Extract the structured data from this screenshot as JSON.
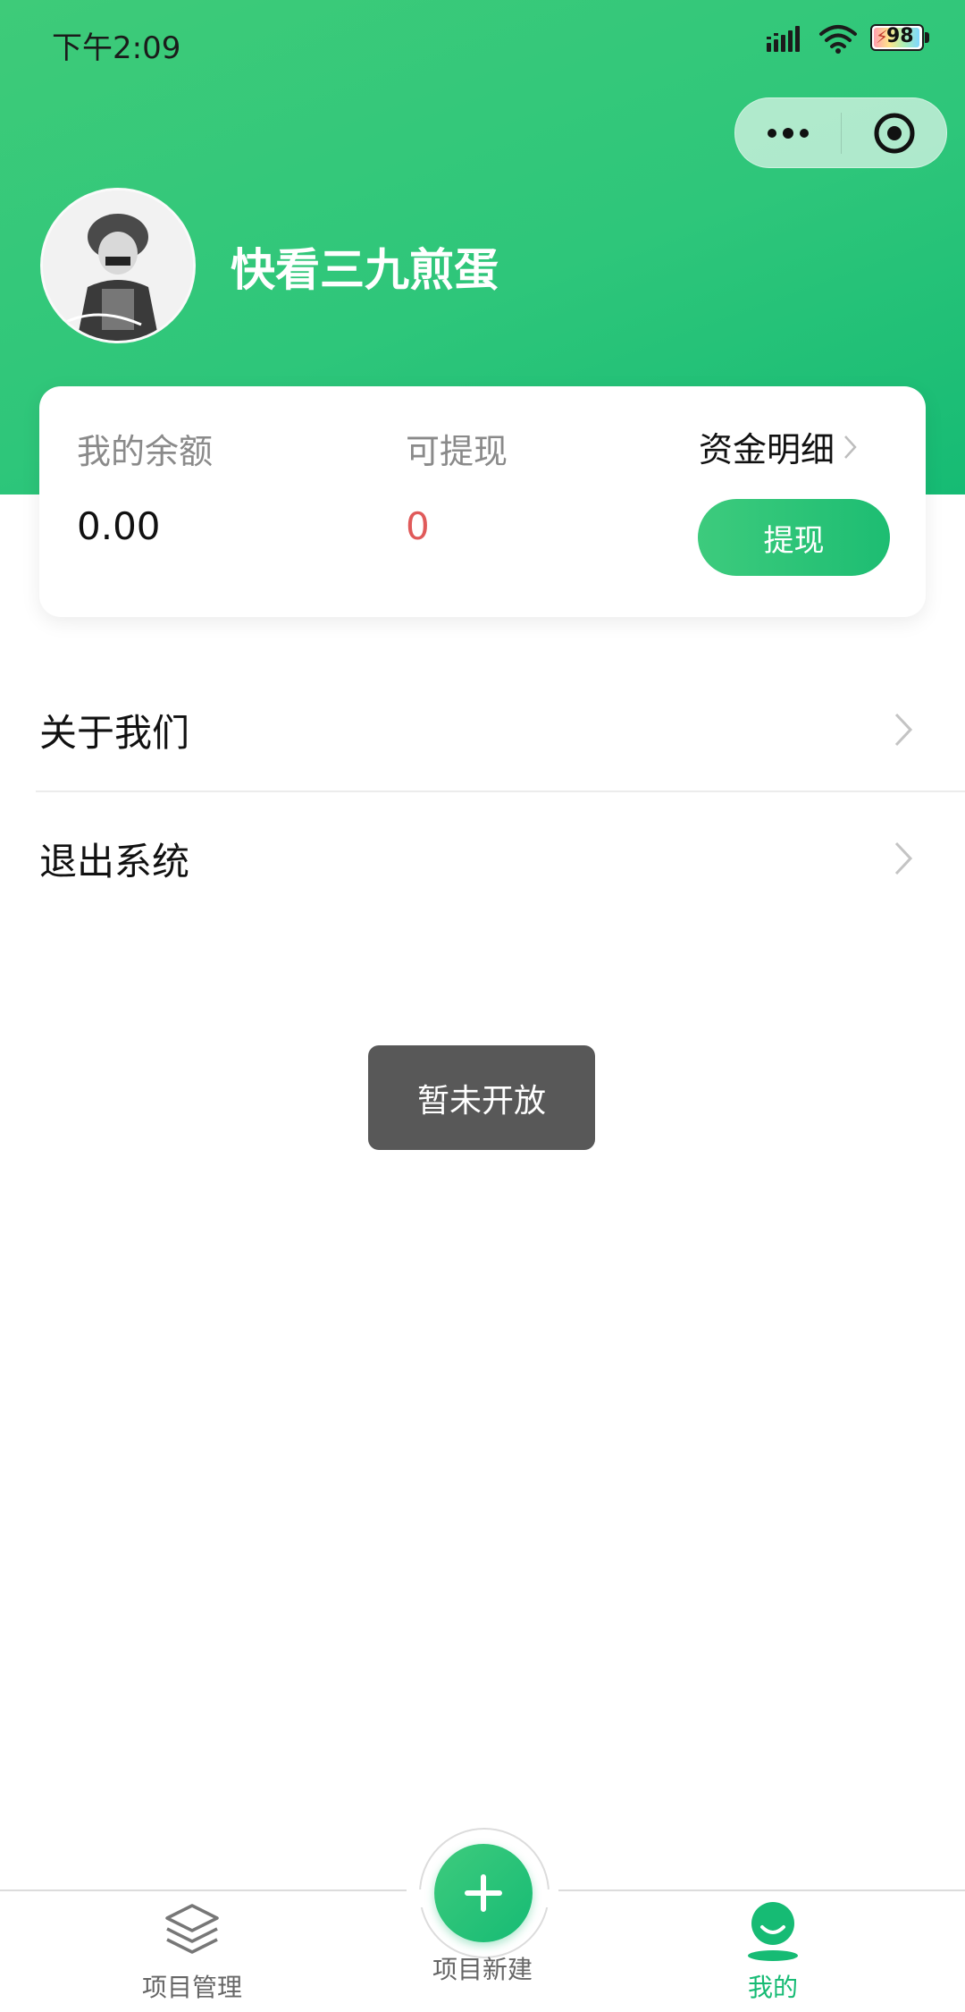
{
  "status_bar": {
    "time": "下午2:09",
    "battery": "98"
  },
  "profile": {
    "username": "快看三九煎蛋"
  },
  "wallet": {
    "balance_label": "我的余额",
    "balance_value": "0.00",
    "withdrawable_label": "可提现",
    "withdrawable_value": "0",
    "detail_link": "资金明细",
    "withdraw_button": "提现"
  },
  "menu": [
    {
      "label": "关于我们"
    },
    {
      "label": "退出系统"
    }
  ],
  "toast": {
    "text": "暂未开放"
  },
  "tabbar": {
    "tabs": [
      {
        "label": "项目管理",
        "icon": "layers-icon"
      },
      {
        "label": "项目新建",
        "icon": "plus-icon"
      },
      {
        "label": "我的",
        "icon": "user-icon"
      }
    ],
    "active_color": "#16bb74",
    "inactive_color": "#666666"
  },
  "colors": {
    "brand": "#2ec67a",
    "withdrawable_value": "#e05a5a"
  }
}
